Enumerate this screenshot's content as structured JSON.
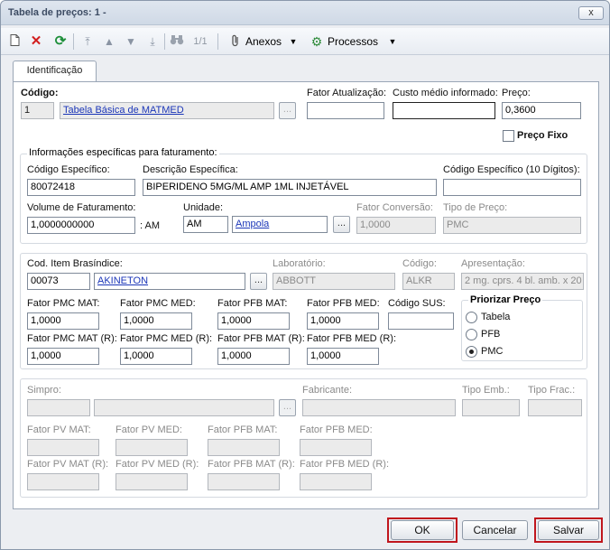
{
  "window": {
    "title": "Tabela de preços: 1 -",
    "close_label": "x"
  },
  "toolbar": {
    "record_position": "1/1",
    "attachments_label": "Anexos",
    "processes_label": "Processos"
  },
  "tabs": [
    {
      "label": "Identificação"
    }
  ],
  "header": {
    "codigo_label": "Código:",
    "codigo_value": "1",
    "codigo_desc": "Tabela Básica de MATMED",
    "fator_atualizacao_label": "Fator Atualização:",
    "fator_atualizacao_value": "",
    "custo_medio_label": "Custo médio informado:",
    "custo_medio_value": "",
    "preco_label": "Preço:",
    "preco_value": "0,3600",
    "preco_fixo_label": "Preço Fixo"
  },
  "faturamento": {
    "group_title": "Informações específicas para faturamento:",
    "codigo_especifico_label": "Código Específico:",
    "codigo_especifico_value": "80072418",
    "descricao_label": "Descrição Específica:",
    "descricao_value": "BIPERIDENO 5MG/ML AMP 1ML INJETÁVEL",
    "codigo10_label": "Código Específico (10 Dígitos):",
    "codigo10_value": "",
    "volume_label": "Volume de Faturamento:",
    "volume_value": "1,0000000000",
    "volume_suffix": ": AM",
    "unidade_label": "Unidade:",
    "unidade_code": "AM",
    "unidade_name": "Ampola",
    "fator_conversao_label": "Fator Conversão:",
    "fator_conversao_value": "1,0000",
    "tipo_preco_label": "Tipo de Preço:",
    "tipo_preco_value": "PMC"
  },
  "brasindice": {
    "cod_item_label": "Cod. Item Brasíndice:",
    "cod_item_value": "00073",
    "cod_item_name": "AKINETON",
    "laboratorio_label": "Laboratório:",
    "laboratorio_value": "ABBOTT",
    "codigo_label": "Código:",
    "codigo_value": "ALKR",
    "apresentacao_label": "Apresentação:",
    "apresentacao_value": "2 mg. cprs. 4 bl. amb. x 20",
    "fator_pmc_mat_label": "Fator PMC MAT:",
    "fator_pmc_mat_value": "1,0000",
    "fator_pmc_med_label": "Fator PMC MED:",
    "fator_pmc_med_value": "1,0000",
    "fator_pfb_mat_label": "Fator PFB MAT:",
    "fator_pfb_mat_value": "1,0000",
    "fator_pfb_med_label": "Fator PFB MED:",
    "fator_pfb_med_value": "1,0000",
    "codigo_sus_label": "Código SUS:",
    "codigo_sus_value": "",
    "fator_pmc_mat_r_label": "Fator PMC MAT (R):",
    "fator_pmc_mat_r_value": "1,0000",
    "fator_pmc_med_r_label": "Fator PMC MED (R):",
    "fator_pmc_med_r_value": "1,0000",
    "fator_pfb_mat_r_label": "Fator PFB MAT (R):",
    "fator_pfb_mat_r_value": "1,0000",
    "fator_pfb_med_r_label": "Fator PFB MED (R):",
    "fator_pfb_med_r_value": "1,0000",
    "priorizar_title": "Priorizar Preço",
    "priorizar_options": [
      "Tabela",
      "PFB",
      "PMC"
    ],
    "priorizar_selected": "PMC"
  },
  "simpro": {
    "simpro_label": "Simpro:",
    "fabricante_label": "Fabricante:",
    "tipo_emb_label": "Tipo Emb.:",
    "tipo_frac_label": "Tipo Frac.:",
    "fator_pv_mat_label": "Fator PV MAT:",
    "fator_pv_med_label": "Fator PV MED:",
    "fator_pfb_mat_label": "Fator PFB MAT:",
    "fator_pfb_med_label": "Fator PFB MED:",
    "fator_pv_mat_r_label": "Fator PV MAT (R):",
    "fator_pv_med_r_label": "Fator PV MED (R):",
    "fator_pfb_mat_r_label": "Fator PFB MAT (R):",
    "fator_pfb_med_r_label": "Fator PFB MED (R):"
  },
  "footer": {
    "ok_label": "OK",
    "cancel_label": "Cancelar",
    "save_label": "Salvar"
  },
  "colors": {
    "highlight": "#c0161d",
    "link": "#1b36b8"
  }
}
